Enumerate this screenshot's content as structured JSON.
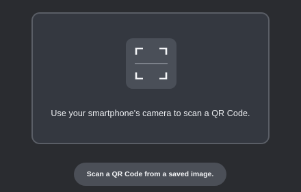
{
  "scanner": {
    "icon": "qr-scan-frame-icon",
    "instruction": "Use your smartphone's camera to scan a QR Code."
  },
  "actions": {
    "scan_saved_image_label": "Scan a QR Code from a saved image."
  },
  "colors": {
    "background": "#2a2c30",
    "panel": "#343840",
    "panel_border": "#5a5e66",
    "icon_tile": "#4a4f58",
    "button": "#4b4f57",
    "text": "#eceef1"
  }
}
